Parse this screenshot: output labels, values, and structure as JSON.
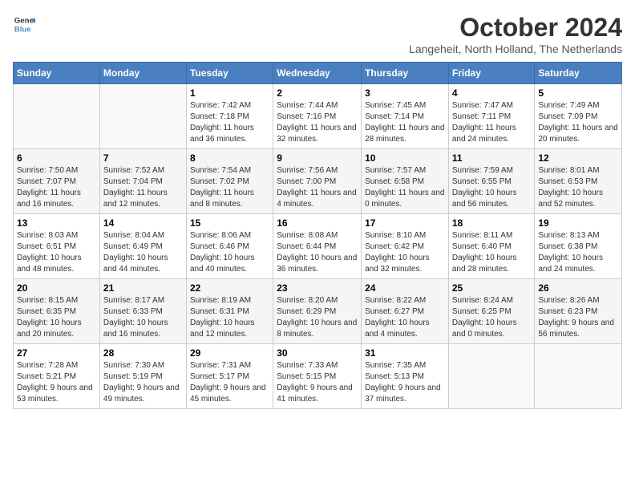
{
  "header": {
    "logo_line1": "General",
    "logo_line2": "Blue",
    "month": "October 2024",
    "location": "Langeheit, North Holland, The Netherlands"
  },
  "days_of_week": [
    "Sunday",
    "Monday",
    "Tuesday",
    "Wednesday",
    "Thursday",
    "Friday",
    "Saturday"
  ],
  "weeks": [
    [
      {
        "num": "",
        "text": ""
      },
      {
        "num": "",
        "text": ""
      },
      {
        "num": "1",
        "text": "Sunrise: 7:42 AM\nSunset: 7:18 PM\nDaylight: 11 hours and 36 minutes."
      },
      {
        "num": "2",
        "text": "Sunrise: 7:44 AM\nSunset: 7:16 PM\nDaylight: 11 hours and 32 minutes."
      },
      {
        "num": "3",
        "text": "Sunrise: 7:45 AM\nSunset: 7:14 PM\nDaylight: 11 hours and 28 minutes."
      },
      {
        "num": "4",
        "text": "Sunrise: 7:47 AM\nSunset: 7:11 PM\nDaylight: 11 hours and 24 minutes."
      },
      {
        "num": "5",
        "text": "Sunrise: 7:49 AM\nSunset: 7:09 PM\nDaylight: 11 hours and 20 minutes."
      }
    ],
    [
      {
        "num": "6",
        "text": "Sunrise: 7:50 AM\nSunset: 7:07 PM\nDaylight: 11 hours and 16 minutes."
      },
      {
        "num": "7",
        "text": "Sunrise: 7:52 AM\nSunset: 7:04 PM\nDaylight: 11 hours and 12 minutes."
      },
      {
        "num": "8",
        "text": "Sunrise: 7:54 AM\nSunset: 7:02 PM\nDaylight: 11 hours and 8 minutes."
      },
      {
        "num": "9",
        "text": "Sunrise: 7:56 AM\nSunset: 7:00 PM\nDaylight: 11 hours and 4 minutes."
      },
      {
        "num": "10",
        "text": "Sunrise: 7:57 AM\nSunset: 6:58 PM\nDaylight: 11 hours and 0 minutes."
      },
      {
        "num": "11",
        "text": "Sunrise: 7:59 AM\nSunset: 6:55 PM\nDaylight: 10 hours and 56 minutes."
      },
      {
        "num": "12",
        "text": "Sunrise: 8:01 AM\nSunset: 6:53 PM\nDaylight: 10 hours and 52 minutes."
      }
    ],
    [
      {
        "num": "13",
        "text": "Sunrise: 8:03 AM\nSunset: 6:51 PM\nDaylight: 10 hours and 48 minutes."
      },
      {
        "num": "14",
        "text": "Sunrise: 8:04 AM\nSunset: 6:49 PM\nDaylight: 10 hours and 44 minutes."
      },
      {
        "num": "15",
        "text": "Sunrise: 8:06 AM\nSunset: 6:46 PM\nDaylight: 10 hours and 40 minutes."
      },
      {
        "num": "16",
        "text": "Sunrise: 8:08 AM\nSunset: 6:44 PM\nDaylight: 10 hours and 36 minutes."
      },
      {
        "num": "17",
        "text": "Sunrise: 8:10 AM\nSunset: 6:42 PM\nDaylight: 10 hours and 32 minutes."
      },
      {
        "num": "18",
        "text": "Sunrise: 8:11 AM\nSunset: 6:40 PM\nDaylight: 10 hours and 28 minutes."
      },
      {
        "num": "19",
        "text": "Sunrise: 8:13 AM\nSunset: 6:38 PM\nDaylight: 10 hours and 24 minutes."
      }
    ],
    [
      {
        "num": "20",
        "text": "Sunrise: 8:15 AM\nSunset: 6:35 PM\nDaylight: 10 hours and 20 minutes."
      },
      {
        "num": "21",
        "text": "Sunrise: 8:17 AM\nSunset: 6:33 PM\nDaylight: 10 hours and 16 minutes."
      },
      {
        "num": "22",
        "text": "Sunrise: 8:19 AM\nSunset: 6:31 PM\nDaylight: 10 hours and 12 minutes."
      },
      {
        "num": "23",
        "text": "Sunrise: 8:20 AM\nSunset: 6:29 PM\nDaylight: 10 hours and 8 minutes."
      },
      {
        "num": "24",
        "text": "Sunrise: 8:22 AM\nSunset: 6:27 PM\nDaylight: 10 hours and 4 minutes."
      },
      {
        "num": "25",
        "text": "Sunrise: 8:24 AM\nSunset: 6:25 PM\nDaylight: 10 hours and 0 minutes."
      },
      {
        "num": "26",
        "text": "Sunrise: 8:26 AM\nSunset: 6:23 PM\nDaylight: 9 hours and 56 minutes."
      }
    ],
    [
      {
        "num": "27",
        "text": "Sunrise: 7:28 AM\nSunset: 5:21 PM\nDaylight: 9 hours and 53 minutes."
      },
      {
        "num": "28",
        "text": "Sunrise: 7:30 AM\nSunset: 5:19 PM\nDaylight: 9 hours and 49 minutes."
      },
      {
        "num": "29",
        "text": "Sunrise: 7:31 AM\nSunset: 5:17 PM\nDaylight: 9 hours and 45 minutes."
      },
      {
        "num": "30",
        "text": "Sunrise: 7:33 AM\nSunset: 5:15 PM\nDaylight: 9 hours and 41 minutes."
      },
      {
        "num": "31",
        "text": "Sunrise: 7:35 AM\nSunset: 5:13 PM\nDaylight: 9 hours and 37 minutes."
      },
      {
        "num": "",
        "text": ""
      },
      {
        "num": "",
        "text": ""
      }
    ]
  ]
}
